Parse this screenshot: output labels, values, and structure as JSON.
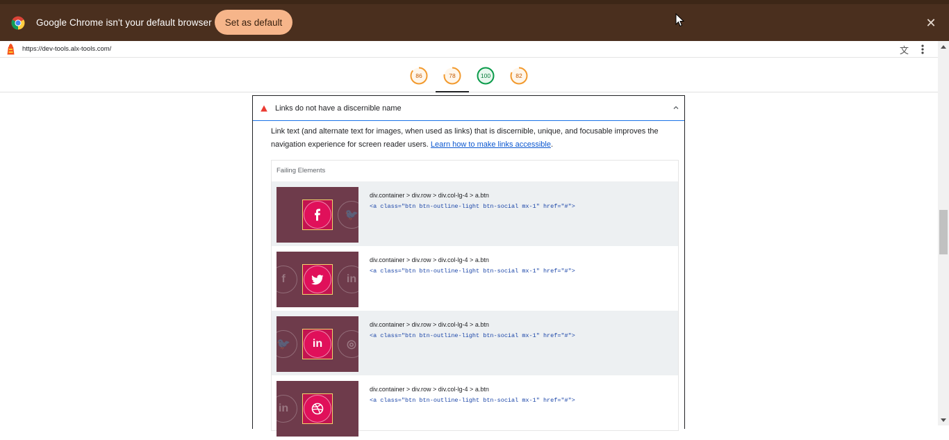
{
  "infobar": {
    "message": "Google Chrome isn't your default browser",
    "set_default_label": "Set as default",
    "close_label": "✕"
  },
  "urlbar": {
    "url": "https://dev-tools.alx-tools.com/",
    "translate_icon": "文A"
  },
  "gauges": [
    {
      "score": "86",
      "color": "#f29a2e"
    },
    {
      "score": "78",
      "color": "#f29a2e"
    },
    {
      "score": "100",
      "color": "#0a9b4a"
    },
    {
      "score": "82",
      "color": "#f29a2e"
    }
  ],
  "audit": {
    "title": "Links do not have a discernible name",
    "description": "Link text (and alternate text for images, when used as links) that is discernible, unique, and focusable improves the navigation experience for screen reader users.",
    "learn_more": "Learn how to make links accessible",
    "period": ".",
    "failing_header": "Failing Elements",
    "rows": [
      {
        "selector": "div.container > div.row > div.col-lg-4 > a.btn",
        "snippet": "<a class=\"btn btn-outline-light btn-social mx-1\" href=\"#\">",
        "icon": "facebook-icon",
        "glyph": "f",
        "left": "",
        "right": "twitter-icon"
      },
      {
        "selector": "div.container > div.row > div.col-lg-4 > a.btn",
        "snippet": "<a class=\"btn btn-outline-light btn-social mx-1\" href=\"#\">",
        "icon": "twitter-icon",
        "glyph": "🐦",
        "left": "facebook-icon",
        "right": "linkedin-icon"
      },
      {
        "selector": "div.container > div.row > div.col-lg-4 > a.btn",
        "snippet": "<a class=\"btn btn-outline-light btn-social mx-1\" href=\"#\">",
        "icon": "linkedin-icon",
        "glyph": "in",
        "left": "twitter-icon",
        "right": "dribbble-icon"
      },
      {
        "selector": "div.container > div.row > div.col-lg-4 > a.btn",
        "snippet": "<a class=\"btn btn-outline-light btn-social mx-1\" href=\"#\">",
        "icon": "dribbble-icon",
        "glyph": "◎",
        "left": "linkedin-icon",
        "right": ""
      }
    ]
  }
}
